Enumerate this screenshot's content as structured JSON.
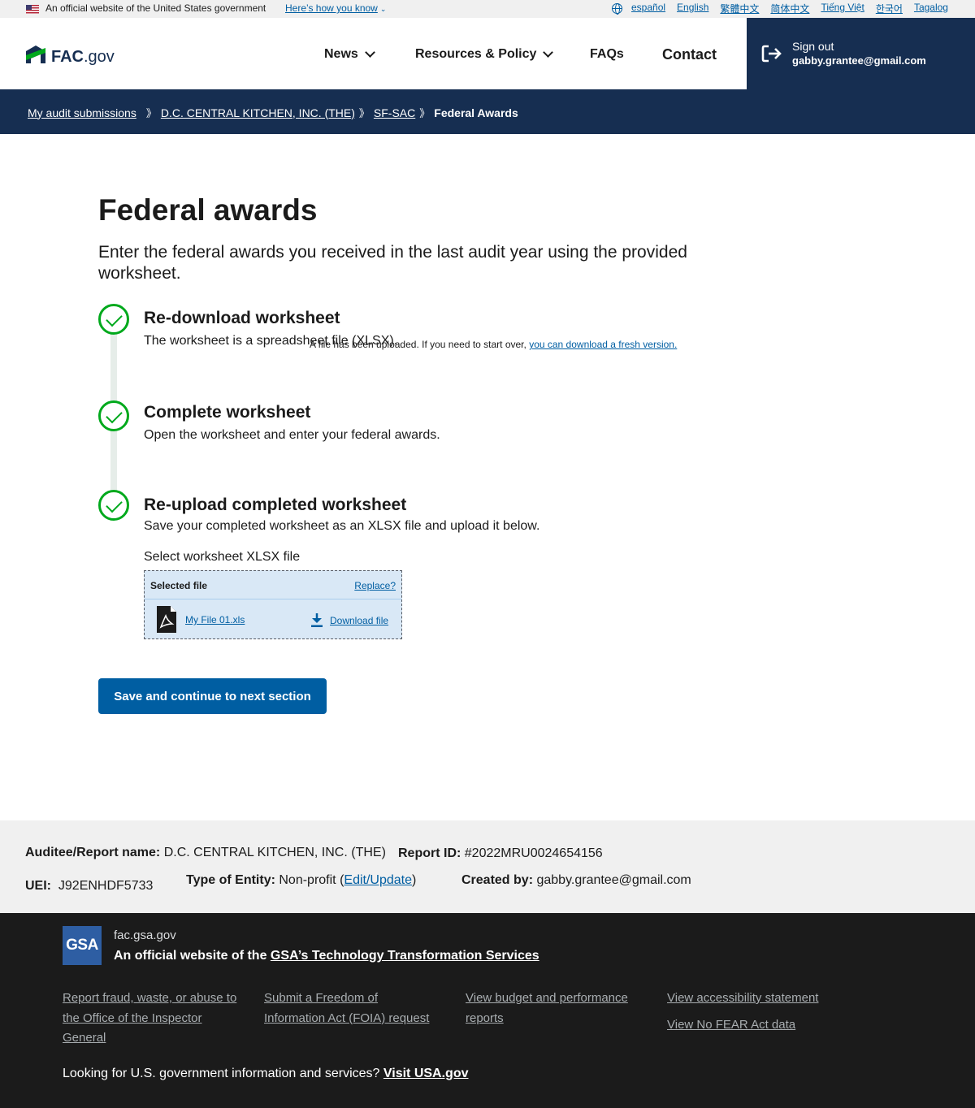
{
  "gov_banner": {
    "text": "An official website of the United States government",
    "how_you_know": "Here’s how you know",
    "languages": [
      "español",
      "English",
      "繁體中文",
      "简体中文",
      "Tiếng Việt",
      "한국어",
      "Tagalog"
    ]
  },
  "header": {
    "logo_bold": "FAC",
    "logo_suffix": ".gov",
    "nav": [
      "News",
      "Resources & Policy",
      "FAQs",
      "Contact"
    ],
    "sign_out_label": "Sign out",
    "user_email": "gabby.grantee@gmail.com"
  },
  "breadcrumb": {
    "items": [
      "My audit submissions",
      "D.C. CENTRAL KITCHEN, INC. (THE)",
      "SF-SAC"
    ],
    "current": "Federal Awards",
    "separator": "》"
  },
  "main": {
    "title": "Federal awards",
    "intro": "Enter the federal awards you received in the last audit year using the provided worksheet.",
    "steps": [
      {
        "heading": "Re-download worksheet",
        "description": "The worksheet is a spreadsheet file (XLSX)."
      },
      {
        "heading": "Complete worksheet",
        "description": "Open the worksheet and enter your federal awards."
      },
      {
        "heading": "Re-upload completed worksheet",
        "description": "Save your completed worksheet as an XLSX file and upload it below."
      }
    ],
    "upload_note": "A file has been uploaded. If you need to start over, ",
    "upload_note_link": "you can download a fresh version.",
    "file_input_label": "Select worksheet XLSX file",
    "file_box": {
      "title": "Selected file",
      "replace": "Replace?",
      "file_name": "My File 01.xls",
      "download": "Download file"
    },
    "save_button": "Save and continue to next section"
  },
  "summary": {
    "auditee_label": "Auditee/Report name:",
    "auditee_value": "D.C. CENTRAL KITCHEN, INC. (THE)",
    "report_id_label": "Report ID:",
    "report_id_value": "#2022MRU0024654156",
    "uei_label": "UEI:",
    "uei_value": "J92ENHDF5733",
    "entity_label": "Type of Entity:",
    "entity_value": "Non-profit",
    "entity_paren_open": "(",
    "entity_edit": "Edit/Update",
    "entity_paren_close": ")",
    "created_label": "Created by:",
    "created_value": "gabby.grantee@gmail.com"
  },
  "footer": {
    "logo_text": "GSA",
    "domain": "fac.gsa.gov",
    "official_prefix": "An official website of the ",
    "official_link": "GSA’s Technology Transformation Services",
    "links": [
      "Report fraud, waste, or abuse to the Office of the Inspector General",
      "Submit a Freedom of Information Act (FOIA) request",
      "View budget and performance reports",
      "View accessibility statement",
      "View No FEAR Act data"
    ],
    "usa_prefix": "Looking for U.S. government information and services? ",
    "usa_link": "Visit USA.gov"
  },
  "colors": {
    "primary": "#005ea2",
    "navy": "#162e51",
    "success": "#00a91c",
    "footer_bg": "#1b1b1b"
  }
}
